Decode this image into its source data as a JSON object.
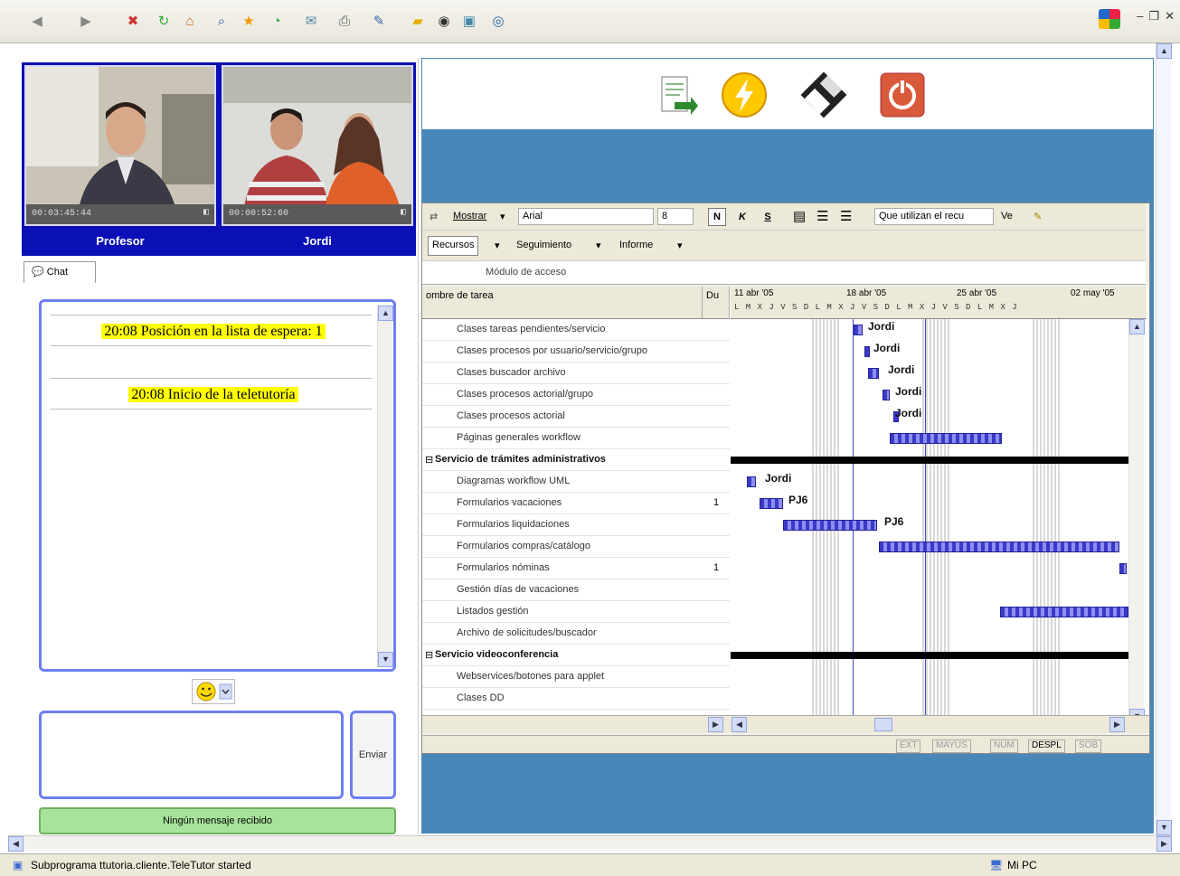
{
  "video": {
    "professor": {
      "timer": "00:03:45:44",
      "name": "Profesor"
    },
    "student": {
      "timer": "00:00:52:60",
      "name": "Jordi"
    }
  },
  "chat": {
    "tab_label": "Chat",
    "messages": [
      "20:08 Posición en la lista de espera: 1",
      "20:08 Inicio de la teletutoría"
    ],
    "send_label": "Enviar",
    "status": "Ningún mensaje recibido"
  },
  "project": {
    "toolbar1": {
      "show_label": "Mostrar",
      "font": "Arial",
      "font_size": "8",
      "bold": "N",
      "italic": "K",
      "underline": "S",
      "filter": "Que utilizan el recu",
      "go": "Ve"
    },
    "toolbar2": {
      "resources": "Recursos",
      "tracking": "Seguimiento",
      "report": "Informe"
    },
    "edit_field": "Módulo de acceso",
    "col_task": "ombre de tarea",
    "col_dur": "Du",
    "weeks": [
      "11 abr '05",
      "18 abr '05",
      "25 abr '05",
      "02 may '05"
    ],
    "days": "L M X J V S D L M X J V S D L M X J V S D L M X J",
    "tasks": [
      {
        "name": "Clases tareas pendientes/servicio",
        "dur": "",
        "summary": false
      },
      {
        "name": "Clases procesos por usuario/servicio/grupo",
        "dur": "",
        "summary": false
      },
      {
        "name": "Clases buscador archivo",
        "dur": "",
        "summary": false
      },
      {
        "name": "Clases procesos actorial/grupo",
        "dur": "",
        "summary": false
      },
      {
        "name": "Clases procesos actorial",
        "dur": "",
        "summary": false
      },
      {
        "name": "Páginas generales workflow",
        "dur": "",
        "summary": false
      },
      {
        "name": "Servicio de trámites administrativos",
        "dur": "",
        "summary": true
      },
      {
        "name": "Diagramas workflow UML",
        "dur": "",
        "summary": false
      },
      {
        "name": "Formularios vacaciones",
        "dur": "1",
        "summary": false
      },
      {
        "name": "Formularios liquidaciones",
        "dur": "",
        "summary": false
      },
      {
        "name": "Formularios compras/catálogo",
        "dur": "",
        "summary": false
      },
      {
        "name": "Formularios nóminas",
        "dur": "1",
        "summary": false
      },
      {
        "name": "Gestión días de vacaciones",
        "dur": "",
        "summary": false
      },
      {
        "name": "Listados gestión",
        "dur": "",
        "summary": false
      },
      {
        "name": "Archivo de solicitudes/buscador",
        "dur": "",
        "summary": false
      },
      {
        "name": "Servicio videoconferencia",
        "dur": "",
        "summary": true
      },
      {
        "name": "Webservices/botones para applet",
        "dur": "",
        "summary": false
      },
      {
        "name": "Clases DD",
        "dur": "",
        "summary": false
      }
    ],
    "gantt_labels": [
      "Jordi",
      "Jordi",
      "Jordi",
      "Jordi",
      "Jordi",
      "Jordi",
      "PJ6",
      "PJ6"
    ],
    "indicators": [
      "EXT",
      "MAYÚS",
      "NUM",
      "DESPL",
      "SOB"
    ]
  },
  "statusbar": {
    "text": "Subprograma ttutoria.cliente.TeleTutor started",
    "zone": "Mi PC"
  },
  "colors": {
    "panel_blue": "#0a10b5",
    "app_bg": "#4a87b9",
    "chat_border": "#6e7ef4",
    "status_green": "#a7e39a"
  }
}
